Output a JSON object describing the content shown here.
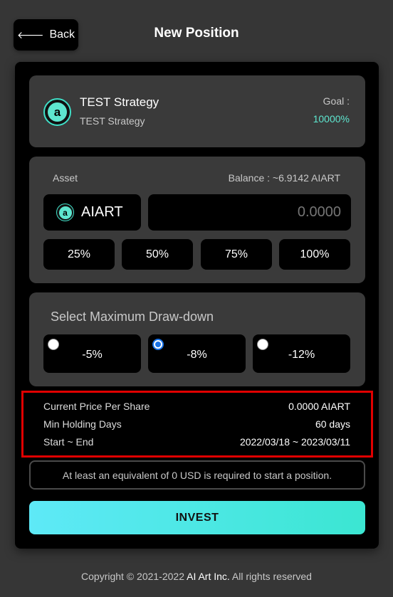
{
  "header": {
    "back_arrow": "🡐",
    "back_label": "Back",
    "title": "New Position"
  },
  "strategy": {
    "logo_letter": "a",
    "name": "TEST Strategy",
    "subtitle": "TEST Strategy",
    "goal_label": "Goal :",
    "goal_value": "10000%"
  },
  "asset": {
    "label": "Asset",
    "balance": "Balance : ~6.9142 AIART",
    "token_logo_letter": "a",
    "token": "AIART",
    "amount_placeholder": "0.0000",
    "percent_buttons": [
      "25%",
      "50%",
      "75%",
      "100%"
    ]
  },
  "drawdown": {
    "title": "Select Maximum Draw-down",
    "options": [
      "-5%",
      "-8%",
      "-12%"
    ],
    "selected": "-8%"
  },
  "info": {
    "price_label": "Current Price Per Share",
    "price_value": "0.0000 AIART",
    "holding_label": "Min Holding Days",
    "holding_value": "60 days",
    "period_label": "Start ~ End",
    "period_value": "2022/03/18 ~ 2023/03/11"
  },
  "notice": "At least an equivalent of 0 USD is required to start a position.",
  "invest_label": "INVEST",
  "footer": {
    "prefix": "Copyright © 2021-2022 ",
    "brand": "AI Art Inc.",
    "suffix": " All rights reserved"
  },
  "colors": {
    "accent": "#5ee6cf",
    "background": "#363636",
    "highlight_border": "#e00000"
  }
}
